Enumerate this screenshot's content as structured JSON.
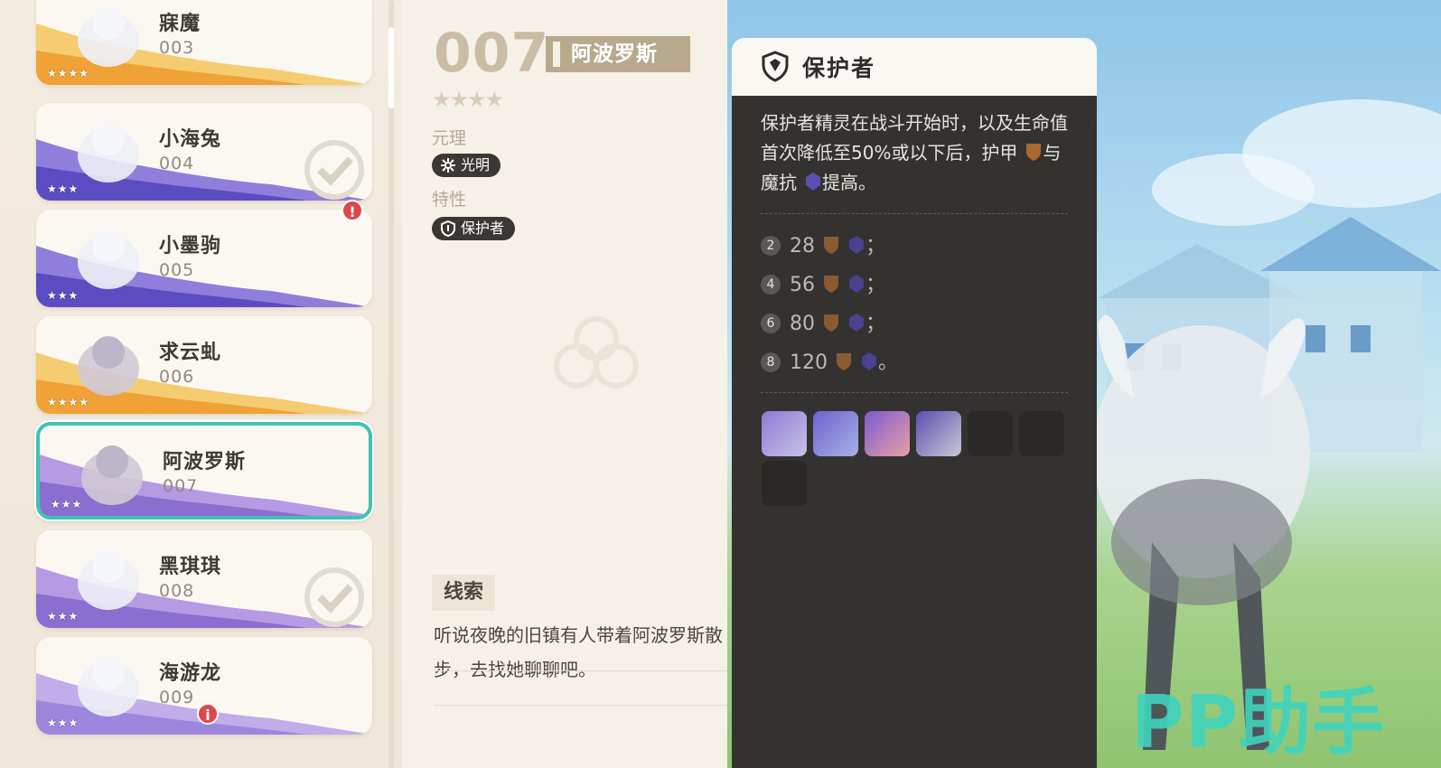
{
  "list": {
    "items": [
      {
        "name": "寐魔",
        "num": "003",
        "stars": "★★★★",
        "wave": "#f4c45a",
        "check": false
      },
      {
        "name": "小海兔",
        "num": "004",
        "stars": "★★★",
        "wave": "#7c68d8",
        "check": true
      },
      {
        "name": "小墨驹",
        "num": "005",
        "stars": "★★★",
        "wave": "#7c68d8",
        "check": false
      },
      {
        "name": "求云虬",
        "num": "006",
        "stars": "★★★★",
        "wave": "#f4c45a",
        "check": false
      },
      {
        "name": "阿波罗斯",
        "num": "007",
        "stars": "★★★",
        "wave": "#a98ae0",
        "check": false
      },
      {
        "name": "黑琪琪",
        "num": "008",
        "stars": "★★★",
        "wave": "#a98ae0",
        "check": true
      },
      {
        "name": "海游龙",
        "num": "009",
        "stars": "★★★",
        "wave": "#b5a0e8",
        "check": false
      }
    ],
    "badge_warning": "!",
    "badge_info": "i"
  },
  "detail": {
    "number": "007",
    "name": "阿波罗斯",
    "stars": "★★★★",
    "element_label": "元理",
    "element_value": "光明",
    "trait_label": "特性",
    "trait_value": "保护者",
    "clue_label": "线索",
    "clue_text": "听说夜晚的旧镇有人带着阿波罗斯散步，去找她聊聊吧。"
  },
  "tooltip": {
    "title": "保护者",
    "desc_1": "保护者精灵在战斗开始时，以及生命值首次降低至50%或以下后，护甲",
    "desc_2": "与魔抗",
    "desc_3": "提高。",
    "stats": [
      {
        "level": "2",
        "value": "28",
        "end": "；"
      },
      {
        "level": "4",
        "value": "56",
        "end": "；"
      },
      {
        "level": "6",
        "value": "80",
        "end": "；"
      },
      {
        "level": "8",
        "value": "120",
        "end": "。"
      }
    ]
  },
  "watermark": "PP助手",
  "colors": {
    "selected": "#3ec3b1",
    "armor": "#a8682e",
    "resist": "#5a4fb0"
  }
}
